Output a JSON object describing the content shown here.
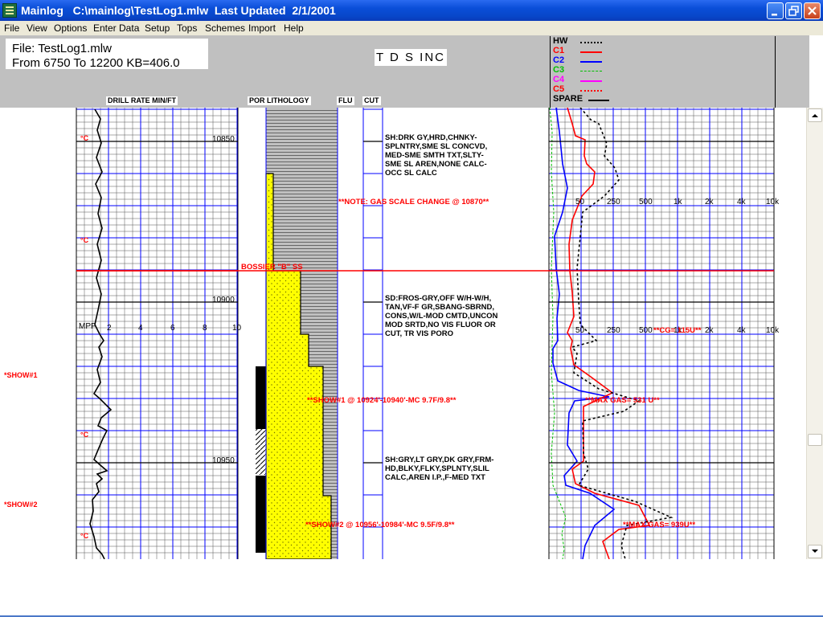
{
  "window": {
    "app_name": "Mainlog",
    "file_path": "C:\\mainlog\\TestLog1.mlw",
    "updated_label": "Last Updated",
    "updated_date": "2/1/2001"
  },
  "menu": [
    "File",
    "View",
    "Options",
    "Enter Data",
    "Setup",
    "Tops",
    "Schemes",
    "Import",
    "Help"
  ],
  "header": {
    "file_line": "File: TestLog1.mlw",
    "range_line": "From 6750  To 12200  KB=406.0",
    "company": "T D S  INC"
  },
  "legend": [
    {
      "name": "HW",
      "color": "#000000",
      "style": "dotted"
    },
    {
      "name": "C1",
      "color": "#ff0000",
      "style": "solid"
    },
    {
      "name": "C2",
      "color": "#0000ff",
      "style": "solid"
    },
    {
      "name": "C3",
      "color": "#00c000",
      "style": "dashed"
    },
    {
      "name": "C4",
      "color": "#ff00ff",
      "style": "solid"
    },
    {
      "name": "C5",
      "color": "#ff0000",
      "style": "dotted"
    },
    {
      "name": "SPARE",
      "color": "#000000",
      "style": "solid"
    }
  ],
  "track_headers": {
    "drill_rate": "DRILL RATE MIN/FT",
    "lithology": "POR LITHOLOGY",
    "fluor": "FLU",
    "cut": "CUT"
  },
  "depth_labels": [
    "10850",
    "10900",
    "10950"
  ],
  "drill_scale": {
    "unit": "MPF",
    "ticks": [
      "2",
      "4",
      "6",
      "8",
      "10"
    ]
  },
  "gas_scale_ticks": [
    "50",
    "250",
    "500",
    "1k",
    "2k",
    "4k",
    "10k"
  ],
  "core_marks": [
    "°C",
    "°C",
    "°C",
    "°C"
  ],
  "shows": [
    "*SHOW#1",
    "*SHOW#2"
  ],
  "descriptions": [
    [
      "SH:DRK GY,HRD,CHNKY-",
      "SPLNTRY,SME SL CONCVD,",
      "MED-SME SMTH TXT,SLTY-",
      "SME SL AREN,NONE CALC-",
      "OCC SL CALC"
    ],
    [
      "SD:FROS-GRY,OFF W/H-W/H,",
      "TAN,VF-F GR,SBANG-SBRND,",
      "CONS,W/L-MOD CMTD,UNCON",
      "MOD SRTD,NO VIS FLUOR OR",
      "CUT, TR VIS PORO"
    ],
    [
      "SH:GRY,LT GRY,DK GRY,FRM-",
      "HD,BLKY,FLKY,SPLNTY,SLIL",
      "CALC,AREN I.P.,F-MED TXT"
    ]
  ],
  "notes": {
    "gas_scale": "**NOTE: GAS SCALE CHANGE @ 10870**",
    "formation": "BOSSIER \"B\" SS",
    "cg": "**CG= 115U**",
    "show1": "**SHOW#1 @ 10924'-10940'-MC 9.7F/9.8**",
    "max_gas1": "**MAX GAS= 531 U**",
    "show2": "**SHOW#2 @ 10956'-10984'-MC 9.5F/9.8**",
    "max_gas2": "**MAX GAS= 939U**"
  },
  "colors": {
    "track_blue": "#0000ff",
    "annotation_red": "#ff0000",
    "sand_yellow": "#ffff00",
    "shale_gray": "#c0c0c0",
    "title_blue": "#0a4ed8"
  }
}
